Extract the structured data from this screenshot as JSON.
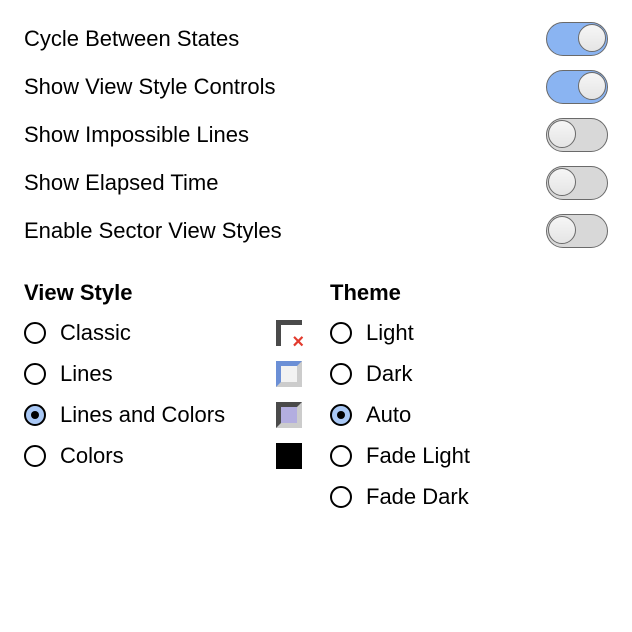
{
  "toggles": [
    {
      "key": "cycle-between-states",
      "label": "Cycle Between States",
      "on": true
    },
    {
      "key": "show-view-style-controls",
      "label": "Show View Style Controls",
      "on": true
    },
    {
      "key": "show-impossible-lines",
      "label": "Show Impossible Lines",
      "on": false
    },
    {
      "key": "show-elapsed-time",
      "label": "Show Elapsed Time",
      "on": false
    },
    {
      "key": "enable-sector-view-styles",
      "label": "Enable Sector View Styles",
      "on": false
    }
  ],
  "viewStyle": {
    "heading": "View Style",
    "options": [
      {
        "key": "classic",
        "label": "Classic",
        "selected": false,
        "icon": "ic-classic"
      },
      {
        "key": "lines",
        "label": "Lines",
        "selected": false,
        "icon": "ic-lines"
      },
      {
        "key": "lines-and-colors",
        "label": "Lines and Colors",
        "selected": true,
        "icon": "ic-lc"
      },
      {
        "key": "colors",
        "label": "Colors",
        "selected": false,
        "icon": "ic-colors"
      }
    ]
  },
  "theme": {
    "heading": "Theme",
    "options": [
      {
        "key": "light",
        "label": "Light",
        "selected": false
      },
      {
        "key": "dark",
        "label": "Dark",
        "selected": false
      },
      {
        "key": "auto",
        "label": "Auto",
        "selected": true
      },
      {
        "key": "fade-light",
        "label": "Fade Light",
        "selected": false
      },
      {
        "key": "fade-dark",
        "label": "Fade Dark",
        "selected": false
      }
    ]
  }
}
